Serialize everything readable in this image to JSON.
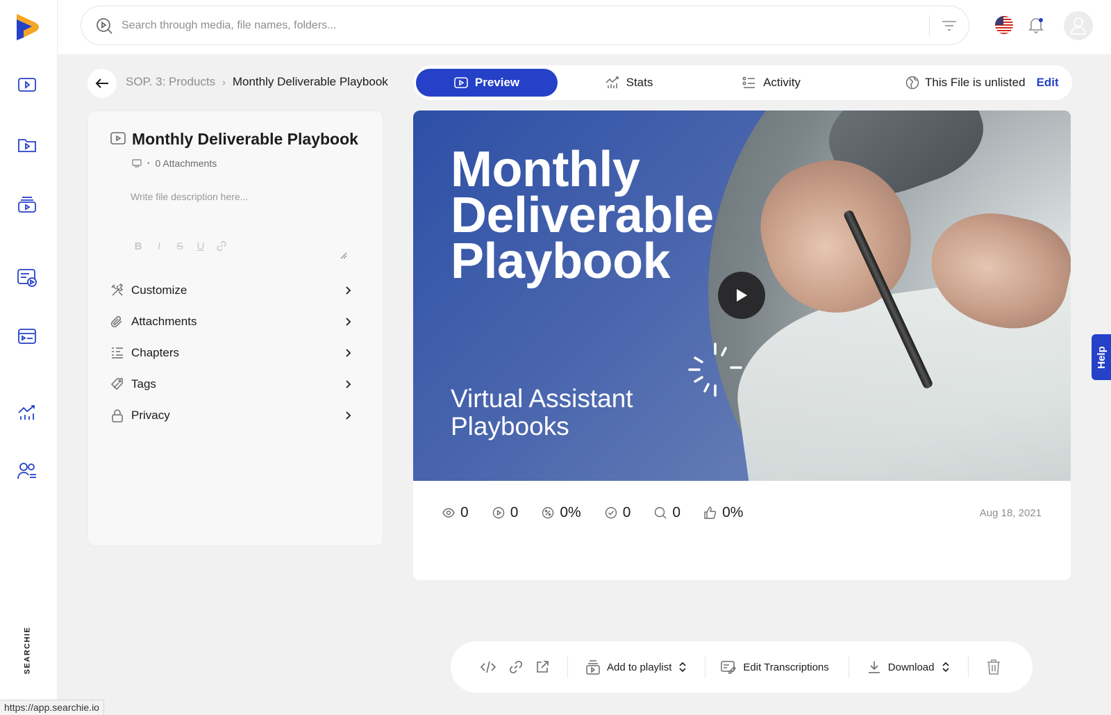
{
  "brand": {
    "name": "SEARCHIE",
    "colors": {
      "accent": "#2541c8",
      "logo_orange": "#f5a623",
      "logo_blue": "#2541c8"
    }
  },
  "rail": {
    "items": [
      "video-library-icon",
      "folders-icon",
      "playlists-icon",
      "hubs-icon",
      "broadcast-icon",
      "analytics-icon",
      "members-icon"
    ]
  },
  "search": {
    "placeholder": "Search through media, file names, folders..."
  },
  "breadcrumb": {
    "parent": "SOP. 3: Products",
    "current": "Monthly Deliverable Playbook"
  },
  "tabs": [
    {
      "label": "Preview",
      "active": true
    },
    {
      "label": "Stats",
      "active": false
    },
    {
      "label": "Activity",
      "active": false
    }
  ],
  "visibility": {
    "status": "This File is unlisted",
    "edit_label": "Edit"
  },
  "file": {
    "title": "Monthly Deliverable Playbook",
    "attachments": "0 Attachments",
    "description_placeholder": "Write file description here...",
    "format_buttons": [
      "B",
      "I",
      "S",
      "U"
    ]
  },
  "menu": [
    {
      "label": "Customize",
      "icon": "customize-icon"
    },
    {
      "label": "Attachments",
      "icon": "paperclip-icon"
    },
    {
      "label": "Chapters",
      "icon": "chapters-icon"
    },
    {
      "label": "Tags",
      "icon": "tag-icon"
    },
    {
      "label": "Privacy",
      "icon": "lock-icon"
    }
  ],
  "thumbnail": {
    "title_lines": [
      "Monthly",
      "Deliverable",
      "Playbook"
    ],
    "subtitle_lines": [
      "Virtual Assistant",
      "Playbooks"
    ]
  },
  "stats": [
    {
      "icon": "views-icon",
      "value": "0"
    },
    {
      "icon": "plays-icon",
      "value": "0"
    },
    {
      "icon": "percent-icon",
      "value": "0%"
    },
    {
      "icon": "completed-icon",
      "value": "0"
    },
    {
      "icon": "search-hits-icon",
      "value": "0"
    },
    {
      "icon": "thumbs-up-icon",
      "value": "0%"
    }
  ],
  "date": "Aug 18, 2021",
  "toolbar": {
    "add_to_playlist": "Add to playlist",
    "edit_transcriptions": "Edit Transcriptions",
    "download": "Download"
  },
  "help_label": "Help",
  "status_url": "https://app.searchie.io"
}
